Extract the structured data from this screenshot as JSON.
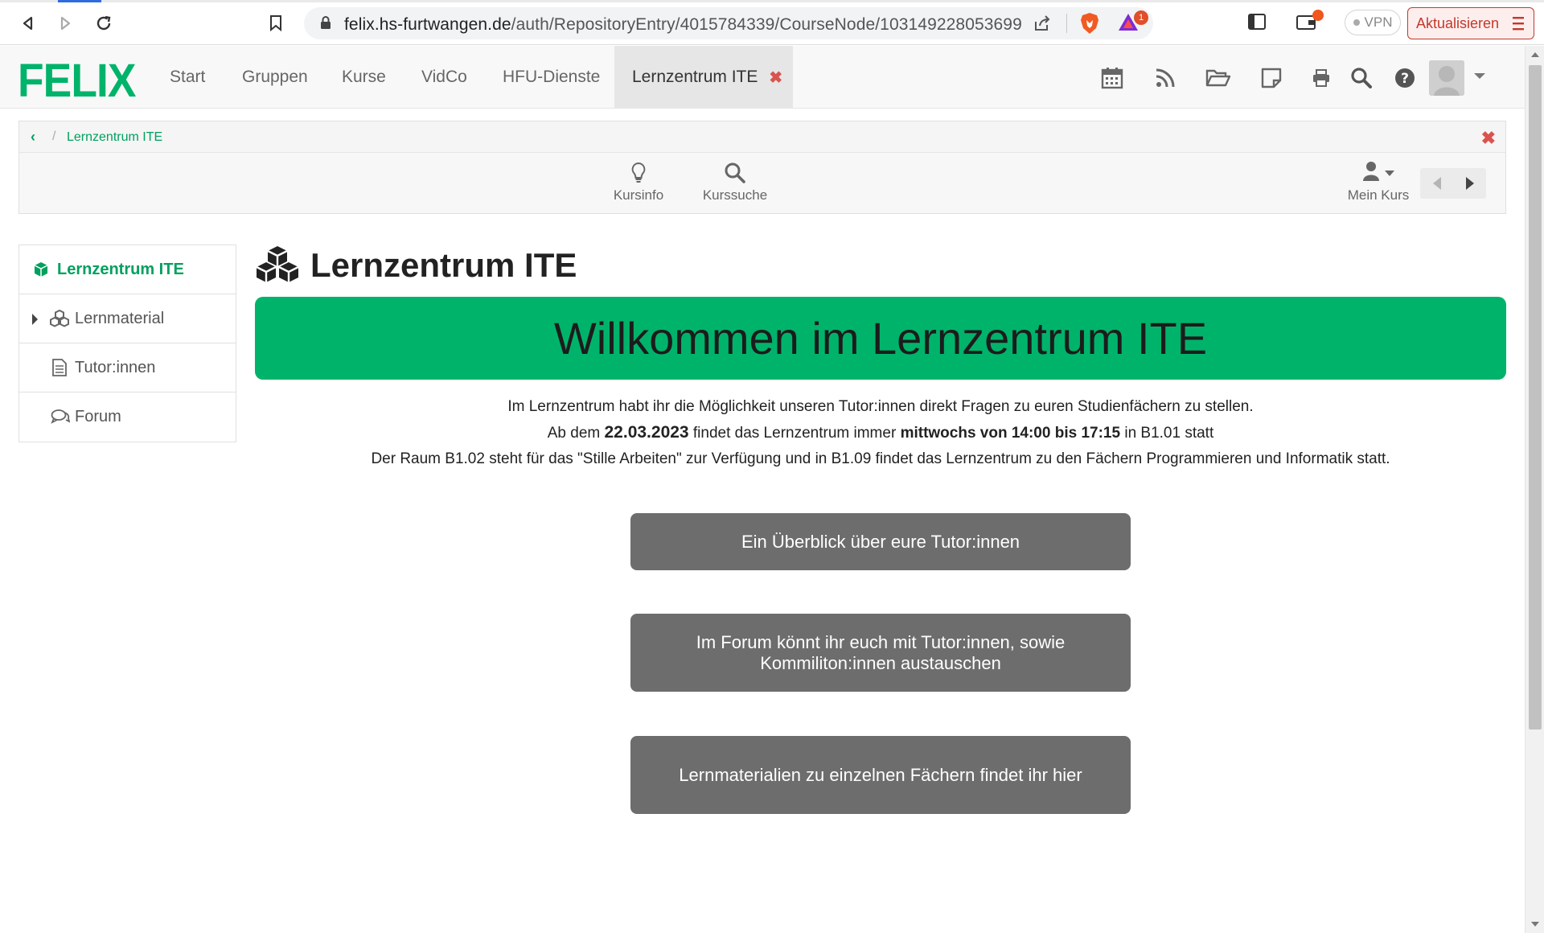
{
  "browser": {
    "url_host": "felix.hs-furtwangen.de",
    "url_path": "/auth/RepositoryEntry/4015784339/CourseNode/103149228053699",
    "rewards_badge": "1",
    "vpn_label": "VPN",
    "update_label": "Aktualisieren"
  },
  "topnav": {
    "logo": "FELIX",
    "links": [
      "Start",
      "Gruppen",
      "Kurse",
      "VidCo",
      "HFU-Dienste"
    ],
    "active_tab": "Lernzentrum ITE",
    "active_tab_close": "✖"
  },
  "course_toolbar": {
    "breadcrumb_back": "‹",
    "breadcrumb_sep": "/",
    "breadcrumb": "Lernzentrum ITE",
    "close": "✖",
    "kursinfo": "Kursinfo",
    "kurssuche": "Kurssuche",
    "mein_kurs": "Mein Kurs"
  },
  "sidebar": {
    "items": [
      {
        "label": "Lernzentrum ITE",
        "icon": "cube-icon",
        "active": true
      },
      {
        "label": "Lernmaterial",
        "icon": "cubes-icon",
        "expandable": true
      },
      {
        "label": "Tutor:innen",
        "icon": "document-icon"
      },
      {
        "label": "Forum",
        "icon": "chat-icon"
      }
    ]
  },
  "main": {
    "title": "Lernzentrum ITE",
    "banner": "Willkommen im Lernzentrum ITE",
    "line1": "Im Lernzentrum habt ihr die Möglichkeit unseren Tutor:innen direkt Fragen zu euren Studienfächern zu stellen.",
    "line2_pre": "Ab dem ",
    "line2_date": "22.03.2023",
    "line2_mid": " findet das Lernzentrum immer ",
    "line2_time": "mittwochs von 14:00 bis 17:15",
    "line2_post": " in B1.01 statt",
    "line3": "Der Raum B1.02 steht für das \"Stille Arbeiten\" zur Verfügung und in B1.09 findet das Lernzentrum zu den Fächern Programmieren und Informatik statt.",
    "buttons": [
      "Ein Überblick über eure Tutor:innen",
      "Im Forum könnt ihr euch mit Tutor:innen, sowie Kommiliton:innen austauschen",
      "Lernmaterialien zu einzelnen Fächern findet ihr hier"
    ]
  },
  "colors": {
    "brand_green": "#00b36b",
    "button_gray": "#6d6d6d",
    "close_red": "#d9534f"
  }
}
